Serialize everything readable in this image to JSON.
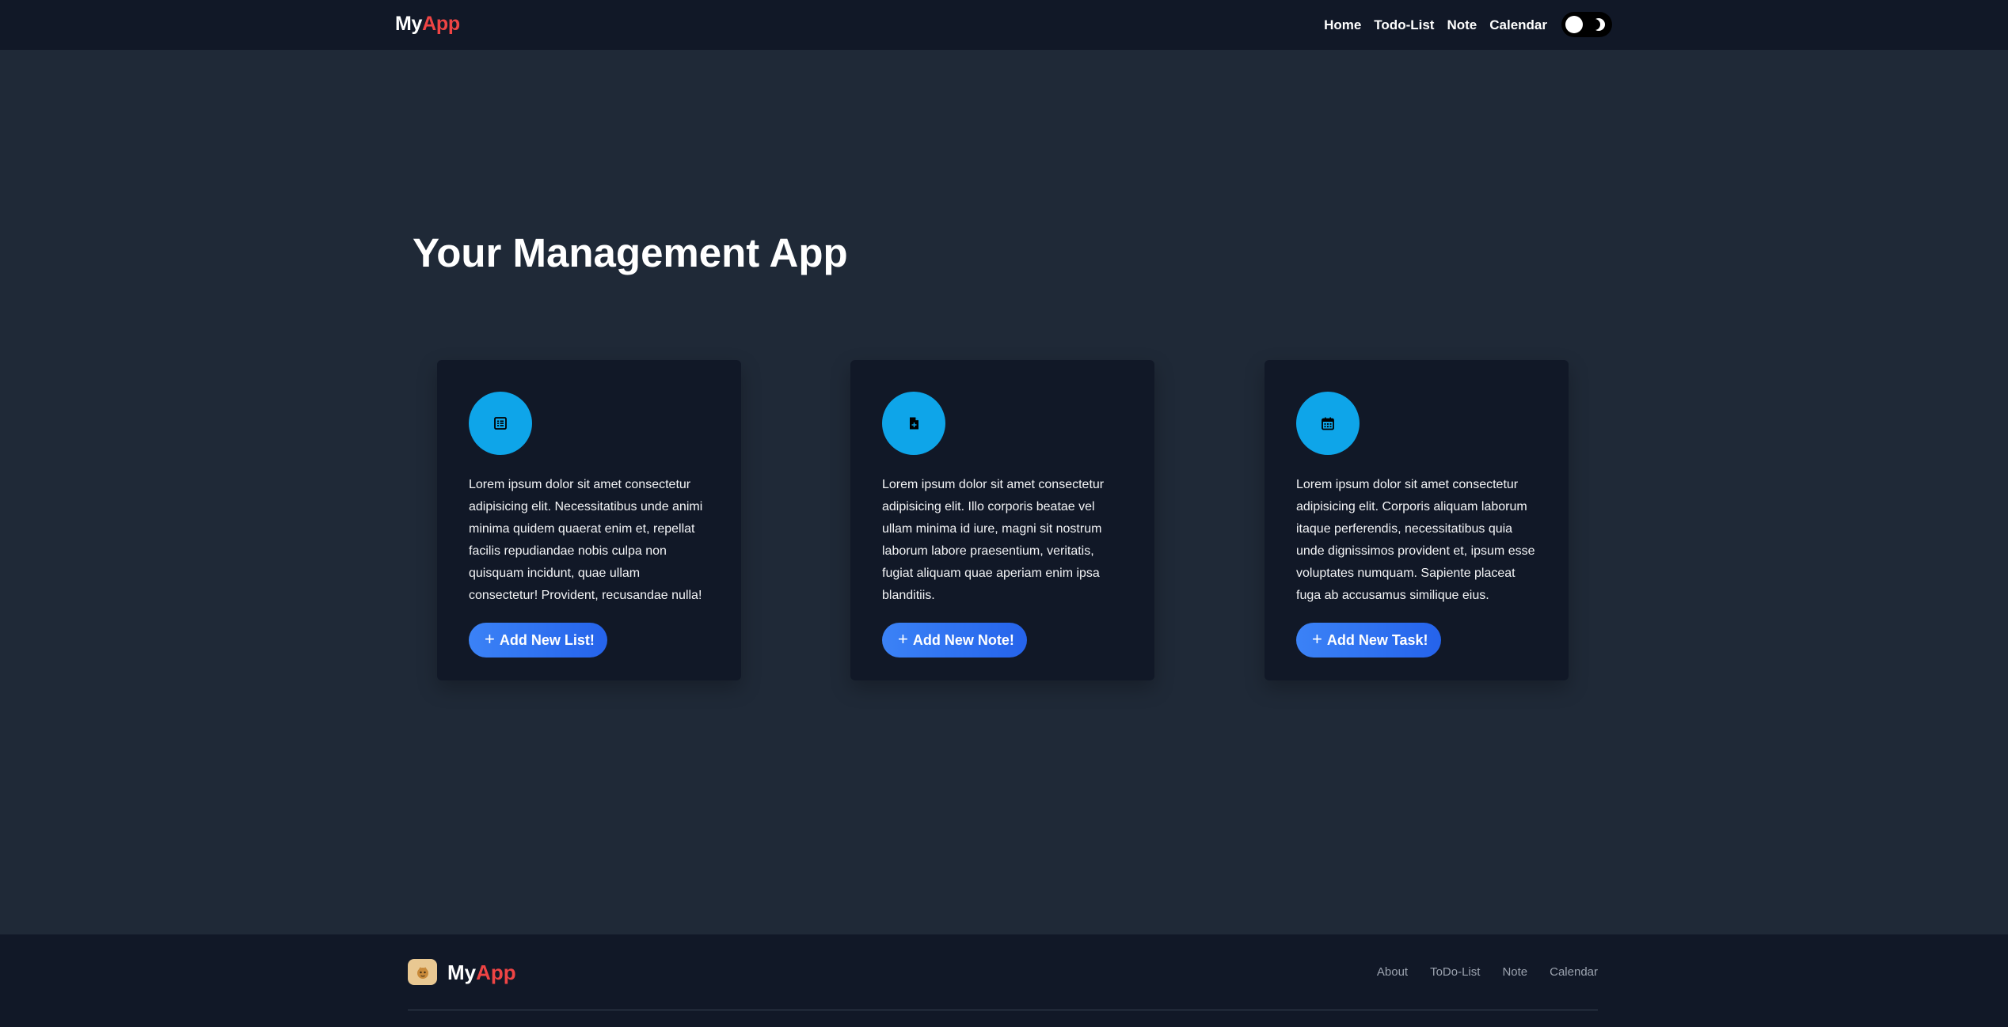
{
  "header": {
    "brand_main": "My",
    "brand_accent": "App",
    "nav": [
      "Home",
      "Todo-List",
      "Note",
      "Calendar"
    ],
    "theme_toggle": "dark-mode-toggle"
  },
  "hero": {
    "title": "Your Management App"
  },
  "cards": [
    {
      "icon": "list-icon",
      "text": "Lorem ipsum dolor sit amet consectetur adipisicing elit. Necessitatibus unde animi minima quidem quaerat enim et, repellat facilis repudiandae nobis culpa non quisquam incidunt, quae ullam consectetur! Provident, recusandae nulla!",
      "button": "Add New List!"
    },
    {
      "icon": "file-plus-icon",
      "text": "Lorem ipsum dolor sit amet consectetur adipisicing elit. Illo corporis beatae vel ullam minima id iure, magni sit nostrum laborum labore praesentium, veritatis, fugiat aliquam quae aperiam enim ipsa blanditiis.",
      "button": "Add New Note!"
    },
    {
      "icon": "calendar-icon",
      "text": "Lorem ipsum dolor sit amet consectetur adipisicing elit. Corporis aliquam laborum itaque perferendis, necessitatibus quia unde dignissimos provident et, ipsum esse voluptates numquam. Sapiente placeat fuga ab accusamus similique eius.",
      "button": "Add New Task!"
    }
  ],
  "footer": {
    "brand_main": "My",
    "brand_accent": "App",
    "links": [
      "About",
      "ToDo-List",
      "Note",
      "Calendar"
    ]
  },
  "colors": {
    "background": "#1f2937",
    "surface": "#111827",
    "accent": "#ef4444",
    "icon_circle": "#0ea5e9",
    "button": "#3b82f6"
  }
}
